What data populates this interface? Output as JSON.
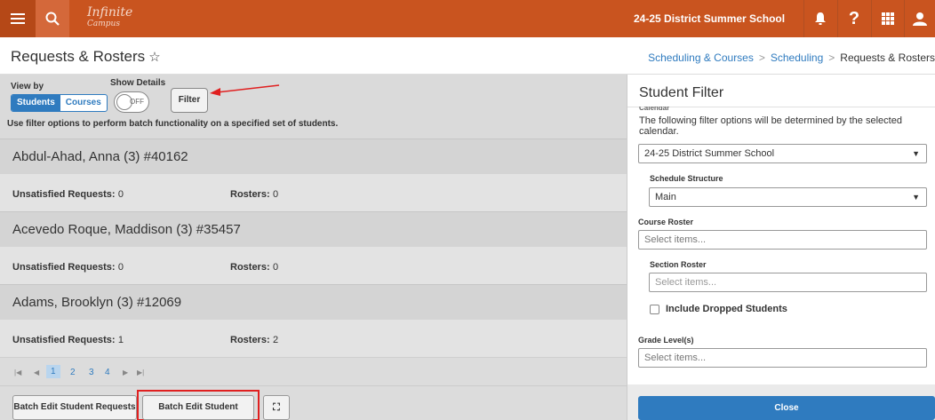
{
  "topbar": {
    "logo_line1": "Infinite",
    "logo_line2": "Campus",
    "school": "24-25 District Summer School",
    "help": "?"
  },
  "header": {
    "page_title": "Requests & Rosters",
    "breadcrumb": [
      "Scheduling & Courses",
      "Scheduling",
      "Requests & Rosters"
    ]
  },
  "controls": {
    "view_by_label": "View by",
    "view_options": [
      "Students",
      "Courses"
    ],
    "selected_view": "Students",
    "show_details_label": "Show Details",
    "toggle_state": "OFF",
    "filter_label": "Filter",
    "info_text": "Use filter options to perform batch functionality on a specified set of students."
  },
  "students": [
    {
      "name": "Abdul-Ahad, Anna (3) #40162",
      "requests_label": "Unsatisfied Requests:",
      "requests": "0",
      "rosters_label": "Rosters:",
      "rosters": "0"
    },
    {
      "name": "Acevedo Roque, Maddison (3) #35457",
      "requests_label": "Unsatisfied Requests:",
      "requests": "0",
      "rosters_label": "Rosters:",
      "rosters": "0"
    },
    {
      "name": "Adams, Brooklyn (3) #12069",
      "requests_label": "Unsatisfied Requests:",
      "requests": "1",
      "rosters_label": "Rosters:",
      "rosters": "2"
    }
  ],
  "pager": {
    "pages": [
      "1",
      "2",
      "3",
      "4"
    ],
    "current": "1"
  },
  "bottom": {
    "batch_requests": "Batch Edit Student Requests",
    "batch_rosters": "Batch Edit Student Rosters"
  },
  "filter_panel": {
    "title": "Student Filter",
    "calendar_label": "Calendar",
    "note": "The following filter options will be determined by the selected calendar.",
    "calendar_value": "24-25 District Summer School",
    "schedule_structure_label": "Schedule Structure",
    "schedule_structure_value": "Main",
    "course_roster_label": "Course Roster",
    "course_roster_placeholder": "Select items...",
    "section_roster_label": "Section Roster",
    "section_roster_placeholder": "Select items...",
    "include_dropped_label": "Include Dropped Students",
    "include_dropped_checked": false,
    "grade_levels_label": "Grade Level(s)",
    "grade_levels_placeholder": "Select items...",
    "close_label": "Close"
  },
  "colors": {
    "brand": "#c9541f",
    "accent": "#2f7bbf",
    "highlight": "#e02020"
  }
}
